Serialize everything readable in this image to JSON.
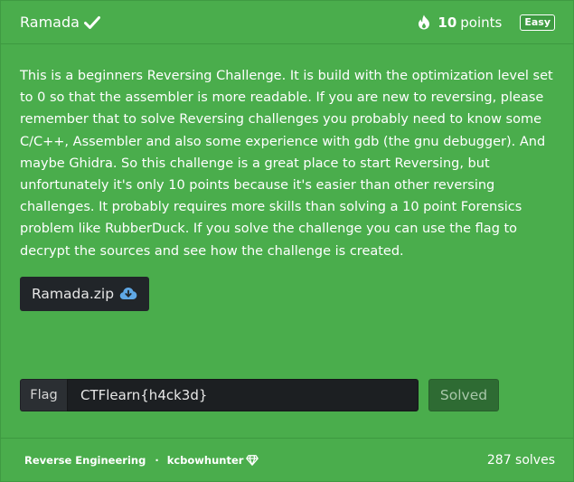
{
  "challenge": {
    "title": "Ramada",
    "points_value": "10",
    "points_label": "points",
    "difficulty": "Easy",
    "description": "This is a beginners Reversing Challenge. It is build with the optimization level set to 0 so that the assembler is more readable. If you are new to reversing, please remember that to solve Reversing challenges you probably need to know some C/C++, Assembler and also some experience with gdb (the gnu debugger). And maybe Ghidra. So this challenge is a great place to start Reversing, but unfortunately it's only 10 points because it's easier than other reversing challenges. It probably requires more skills than solving a 10 point Forensics problem like RubberDuck. If you solve the challenge you can use the flag to decrypt the sources and see how the challenge is created.",
    "download_label": "Ramada.zip"
  },
  "flag": {
    "label": "Flag",
    "value": "CTFlearn{h4ck3d}",
    "button_label": "Solved"
  },
  "footer": {
    "category": "Reverse Engineering",
    "separator": "·",
    "author": "kcbowhunter",
    "solves": "287 solves"
  },
  "icons": {
    "solved": "check-icon",
    "points": "fire-icon",
    "download": "cloud-download-icon",
    "author_badge": "diamond-icon"
  },
  "colors": {
    "card_background": "#4aad4c",
    "dark_button": "#212529",
    "solved_button": "#2e6b33"
  }
}
